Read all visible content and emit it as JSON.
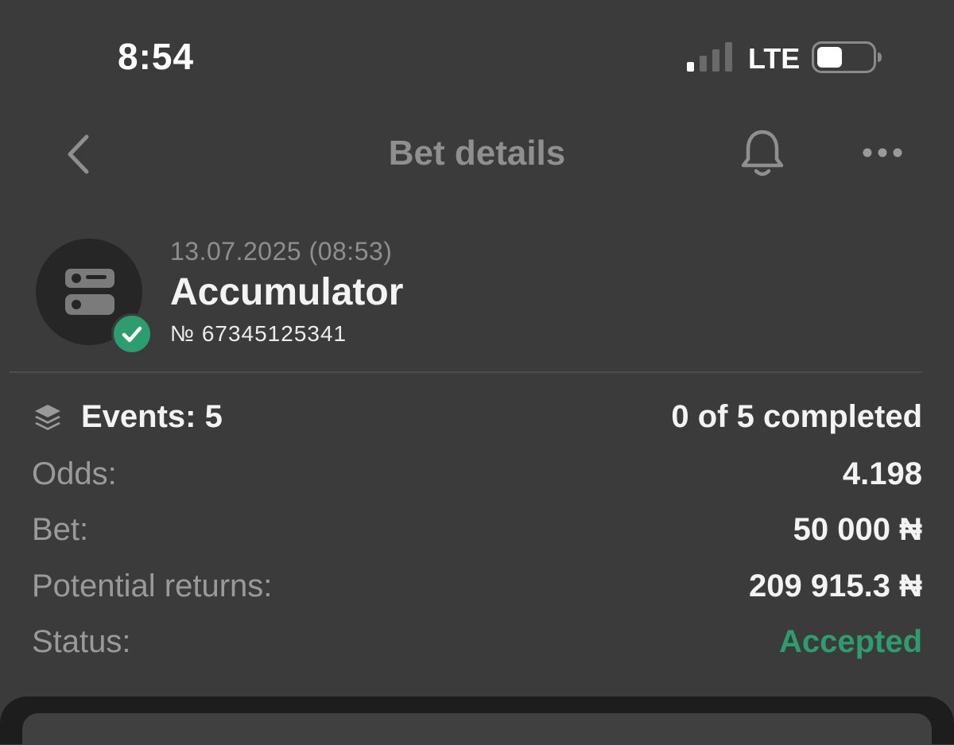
{
  "status_bar": {
    "time": "8:54",
    "network": "LTE",
    "signal_bars_active": 1,
    "signal_bars_total": 4,
    "battery_level": 0.45
  },
  "header": {
    "title": "Bet details",
    "back_icon": "chevron-left-icon",
    "notification_icon": "bell-icon",
    "more_icon": "ellipsis-icon"
  },
  "bet": {
    "datetime": "13.07.2025 (08:53)",
    "type": "Accumulator",
    "number": "№ 67345125341",
    "icon": "accumulator-icon",
    "badge_icon": "check-circle-icon"
  },
  "details": {
    "events_icon": "layers-icon",
    "events_label": "Events: 5",
    "events_progress": "0 of 5 completed",
    "odds_label": "Odds:",
    "odds_value": "4.198",
    "bet_label": "Bet:",
    "bet_value": "50 000 ₦",
    "returns_label": "Potential returns:",
    "returns_value": "209 915.3 ₦",
    "status_label": "Status:",
    "status_value": "Accepted"
  },
  "colors": {
    "background": "#3b3b3b",
    "accent_green": "#2d9c6f",
    "muted_text": "#9a9a9a"
  }
}
